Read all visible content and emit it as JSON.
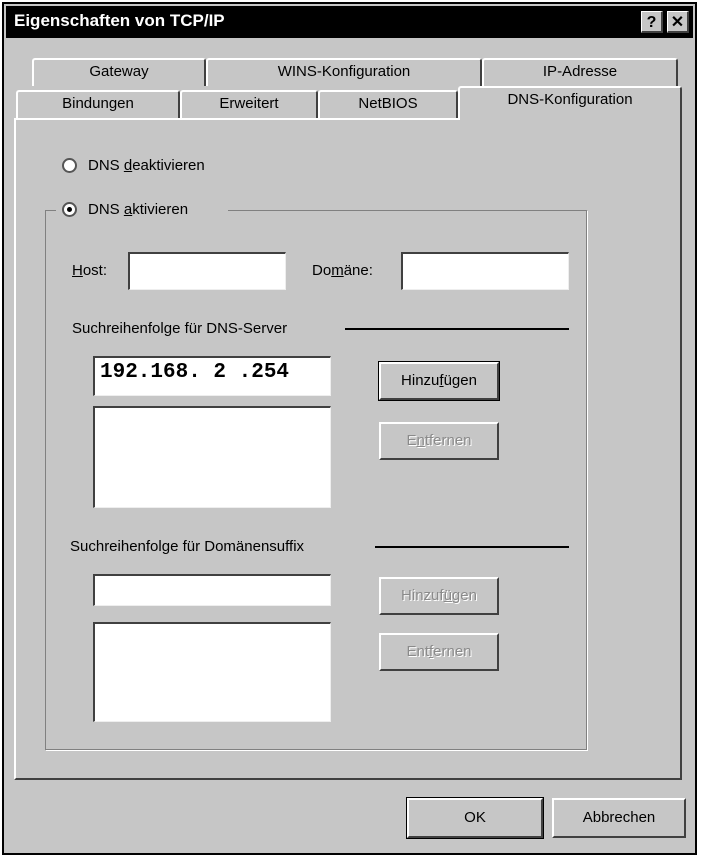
{
  "window": {
    "title": "Eigenschaften von TCP/IP",
    "help_glyph": "?",
    "close_glyph": "✕"
  },
  "tabs": {
    "back": [
      {
        "label": "Gateway"
      },
      {
        "label": "WINS-Konfiguration"
      },
      {
        "label": "IP-Adresse"
      }
    ],
    "front": [
      {
        "label": "Bindungen"
      },
      {
        "label": "Erweitert"
      },
      {
        "label": "NetBIOS"
      },
      {
        "label": "DNS-Konfiguration",
        "active": true
      }
    ]
  },
  "dns": {
    "deactivate": {
      "prefix": "DNS ",
      "accel": "d",
      "rest": "eaktivieren",
      "selected": false
    },
    "activate": {
      "prefix": "DNS ",
      "accel": "a",
      "rest": "ktivieren",
      "selected": true
    },
    "host_label_accel": "H",
    "host_label_rest": "ost:",
    "host_value": "",
    "domain_label_pre": "Do",
    "domain_label_accel": "m",
    "domain_label_rest": "äne:",
    "domain_value": "",
    "server_section": "Suchreihenfolge für DNS-Server",
    "server_input": "192.168. 2 .254",
    "add_pre": "Hinzu",
    "add_accel": "f",
    "add_rest": "ügen",
    "remove_pre": "E",
    "remove_accel": "n",
    "remove_rest": "tfernen",
    "suffix_section": "Suchreihenfolge für Domänensuffix",
    "suffix_input": "",
    "add2_pre": "Hinzuf",
    "add2_accel": "ü",
    "add2_rest": "gen",
    "remove2_pre": "Ent",
    "remove2_accel": "f",
    "remove2_rest": "ernen"
  },
  "footer": {
    "ok": "OK",
    "cancel": "Abbrechen"
  }
}
